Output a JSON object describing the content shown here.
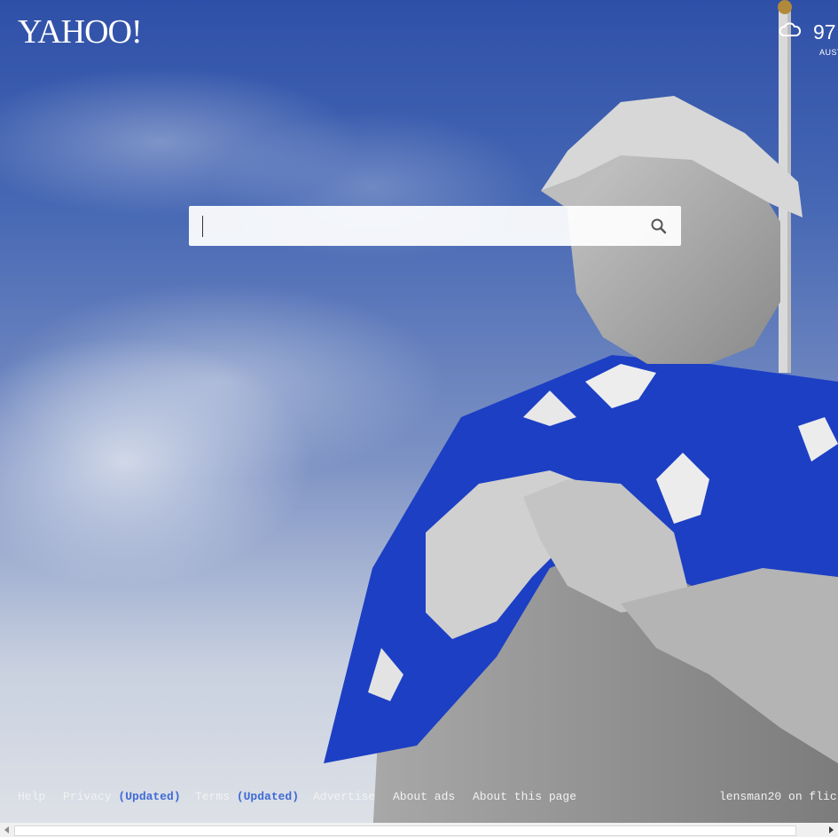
{
  "header": {
    "logo_text": "YAHOO!",
    "weather": {
      "temperature": "97",
      "location": "AUST",
      "icon": "cloudy-night-icon"
    }
  },
  "search": {
    "value": "",
    "placeholder": "",
    "button_icon": "search-icon"
  },
  "footer": {
    "links": [
      {
        "label": "Help"
      },
      {
        "label": "Privacy",
        "badge": "(Updated)"
      },
      {
        "label": "Terms",
        "badge": "(Updated)"
      },
      {
        "label": "Advertise"
      },
      {
        "label": "About ads"
      },
      {
        "label": "About this page"
      }
    ],
    "credit": "lensman20 on flic"
  },
  "colors": {
    "link_badge": "#3f6bd6",
    "text": "#f2f2f2",
    "sky": "#4768b4",
    "flag_blue": "#1c3fc4"
  }
}
